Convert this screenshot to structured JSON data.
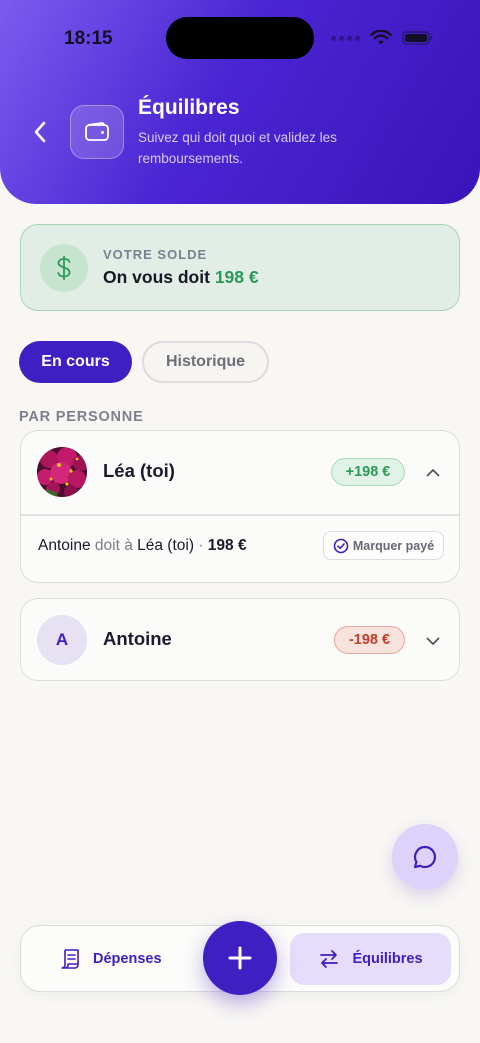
{
  "status_bar": {
    "time": "18:15"
  },
  "header": {
    "title": "Équilibres",
    "subtitle": "Suivez qui doit quoi et validez les remboursements."
  },
  "balance": {
    "label": "VOTRE SOLDE",
    "prefix": "On vous doit",
    "amount": "198 €",
    "accent_color": "#2b9a57"
  },
  "tabs": [
    {
      "label": "En cours",
      "active": true
    },
    {
      "label": "Historique",
      "active": false
    }
  ],
  "section_label": "PAR PERSONNE",
  "people": [
    {
      "name": "Léa (toi)",
      "avatar": "photo",
      "balance": "+198 €",
      "expanded": true,
      "debt": {
        "debtor": "Antoine",
        "verb": "doit à",
        "creditor": "Léa (toi)",
        "separator": "·",
        "amount": "198 €",
        "action_label": "Marquer payé"
      }
    },
    {
      "name": "Antoine",
      "avatar_letter": "A",
      "balance": "-198 €",
      "expanded": false
    }
  ],
  "bottom_nav": {
    "expenses_label": "Dépenses",
    "balances_label": "Équilibres"
  },
  "colors": {
    "brand": "#3e1fc2",
    "positive": "#2b9a57",
    "negative": "#c23e2a"
  },
  "icons": {
    "back": "chevron-left-icon",
    "header": "wallet-icon",
    "balance": "dollar-icon",
    "chat": "chat-bubble-icon",
    "expenses": "receipt-icon",
    "balances": "swap-arrows-icon",
    "add": "plus-icon"
  }
}
